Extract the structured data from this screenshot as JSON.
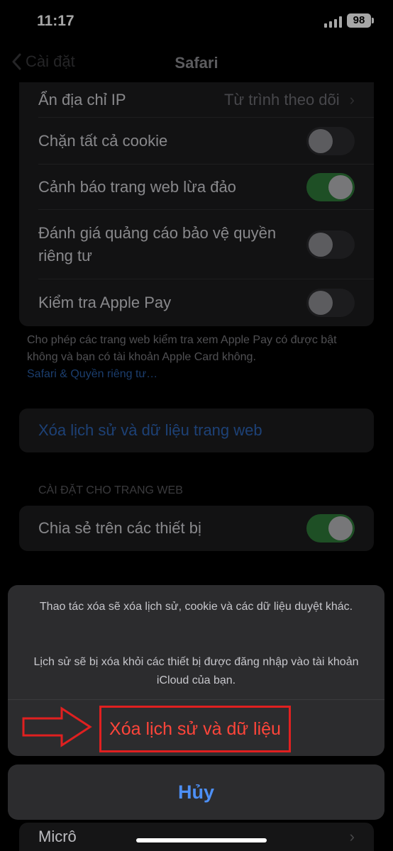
{
  "status": {
    "time": "11:17",
    "battery": "98"
  },
  "nav": {
    "back_label": "Cài đặt",
    "title": "Safari"
  },
  "privacy": {
    "hide_ip": {
      "label": "Ẩn địa chỉ IP",
      "value": "Từ trình theo dõi"
    },
    "block_cookies": {
      "label": "Chặn tất cả cookie",
      "on": false
    },
    "fraud_warning": {
      "label": "Cảnh báo trang web lừa đảo",
      "on": true
    },
    "ad_measurement": {
      "label": "Đánh giá quảng cáo bảo vệ quyền riêng tư",
      "on": false
    },
    "apple_pay": {
      "label": "Kiểm tra Apple Pay",
      "on": false
    },
    "footer": "Cho phép các trang web kiểm tra xem Apple Pay có được bật không và bạn có tài khoản Apple Card không.",
    "footer_link": "Safari & Quyền riêng tư…"
  },
  "clear_history_label": "Xóa lịch sử và dữ liệu trang web",
  "site_settings": {
    "header": "CÀI ĐẶT CHO TRANG WEB",
    "share_across_devices": {
      "label": "Chia sẻ trên các thiết bị",
      "on": true
    }
  },
  "sheet": {
    "message1": "Thao tác xóa sẽ xóa lịch sử, cookie và các dữ liệu duyệt khác.",
    "message2": "Lịch sử sẽ bị xóa khỏi các thiết bị được đăng nhập vào tài khoản iCloud của bạn.",
    "destructive_label": "Xóa lịch sử và dữ liệu",
    "cancel_label": "Hủy"
  },
  "below": {
    "micro_label": "Micrô"
  },
  "colors": {
    "accent_red": "#e02020",
    "toggle_on": "#34c759",
    "link_blue": "#0a84ff"
  }
}
